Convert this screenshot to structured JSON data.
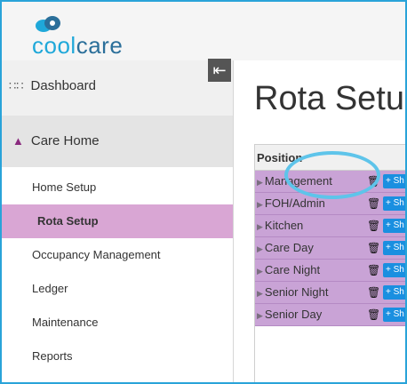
{
  "brand": {
    "text_cool": "cool",
    "text_care": "care",
    "color": "#1fa8d9"
  },
  "sidebar": {
    "dashboard_label": "Dashboard",
    "section_label": "Care Home",
    "items": [
      {
        "label": "Home Setup"
      },
      {
        "label": "Rota Setup",
        "active": true
      },
      {
        "label": "Occupancy Management"
      },
      {
        "label": "Ledger"
      },
      {
        "label": "Maintenance"
      },
      {
        "label": "Reports"
      }
    ]
  },
  "main": {
    "title": "Rota Setu",
    "table": {
      "header": "Position",
      "rows": [
        {
          "name": "Management",
          "button": "+ Sh"
        },
        {
          "name": "FOH/Admin",
          "button": "+ Sh"
        },
        {
          "name": "Kitchen",
          "button": "+ Sh"
        },
        {
          "name": "Care Day",
          "button": "+ Sh"
        },
        {
          "name": "Care Night",
          "button": "+ Sh"
        },
        {
          "name": "Senior Night",
          "button": "+ Sh"
        },
        {
          "name": "Senior Day",
          "button": "+ Sh"
        }
      ]
    }
  },
  "colors": {
    "frame": "#29a3d9",
    "active_row": "#d9a6d4",
    "table_row": "#c9a3d6",
    "button": "#1a8fe0",
    "highlight": "#5ec4ea"
  }
}
